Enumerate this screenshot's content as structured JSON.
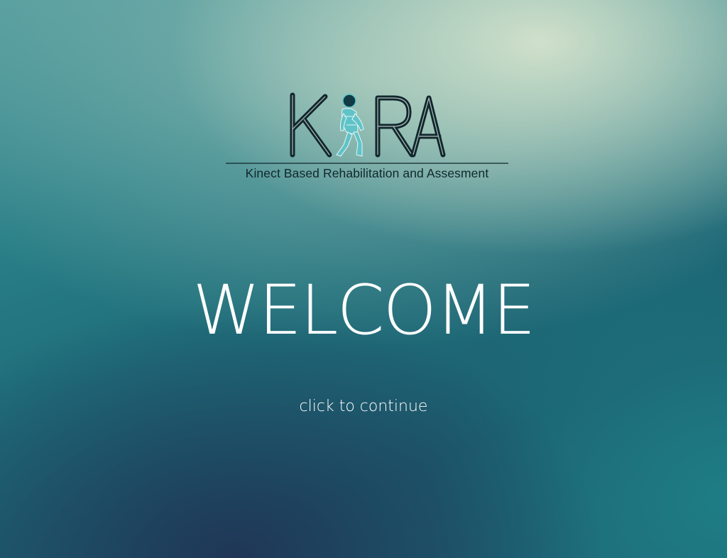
{
  "app": {
    "logo_text": "KIRA",
    "logo_subtitle": "Kinect Based Rehabilitation and Assesment"
  },
  "main": {
    "welcome_text": "WELCOME",
    "continue_text": "click to continue"
  },
  "colors": {
    "logo_text": "#10272c",
    "logo_figure": "#5fc3c8",
    "welcome_text": "#ffffff",
    "background_light": "#d2e2cc",
    "background_teal": "#1f6f7b",
    "background_dark": "#203456"
  },
  "icons": {
    "logo_figure": "walking-person-icon"
  }
}
